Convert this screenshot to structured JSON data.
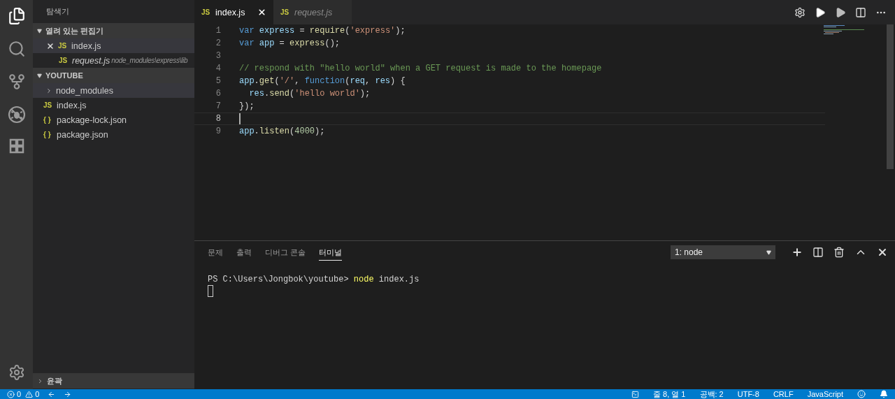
{
  "sidebar": {
    "title": "탐색기",
    "sections": [
      {
        "title": "열려 있는 편집기",
        "expanded": true,
        "items": [
          {
            "kind": "open-editor",
            "badge": "JS",
            "name": "index.js",
            "selected": true,
            "preview": false,
            "closable": true
          },
          {
            "kind": "open-editor",
            "badge": "JS",
            "name": "request.js",
            "description": "node_modules\\express\\lib",
            "selected": false,
            "preview": true,
            "closable": false
          }
        ]
      },
      {
        "title": "YOUTUBE",
        "expanded": true,
        "items": [
          {
            "kind": "folder",
            "name": "node_modules",
            "expanded": false,
            "selected": true
          },
          {
            "kind": "file",
            "badge": "JS",
            "name": "index.js",
            "selected": false
          },
          {
            "kind": "file",
            "badge": "{ }",
            "name": "package-lock.json",
            "selected": false
          },
          {
            "kind": "file",
            "badge": "{ }",
            "name": "package.json",
            "selected": false
          }
        ]
      }
    ],
    "outline": {
      "title": "윤곽",
      "expanded": false
    }
  },
  "tabs": [
    {
      "badge": "JS",
      "name": "index.js",
      "selected": true,
      "preview": false
    },
    {
      "badge": "JS",
      "name": "request.js",
      "selected": false,
      "preview": true
    }
  ],
  "code": [
    {
      "number": "1",
      "current": false,
      "tokens": [
        {
          "kind": "keyword",
          "text": "var "
        },
        {
          "kind": "variable",
          "text": "express"
        },
        {
          "kind": "plain",
          "text": " = "
        },
        {
          "kind": "function",
          "text": "require"
        },
        {
          "kind": "plain",
          "text": "("
        },
        {
          "kind": "string",
          "text": "'express'"
        },
        {
          "kind": "plain",
          "text": ");"
        }
      ]
    },
    {
      "number": "2",
      "current": false,
      "tokens": [
        {
          "kind": "keyword",
          "text": "var "
        },
        {
          "kind": "variable",
          "text": "app"
        },
        {
          "kind": "plain",
          "text": " = "
        },
        {
          "kind": "function",
          "text": "express"
        },
        {
          "kind": "plain",
          "text": "();"
        }
      ]
    },
    {
      "number": "3",
      "current": false
    },
    {
      "number": "4",
      "current": false,
      "tokens": [
        {
          "kind": "comment",
          "text": "// respond with \"hello world\" when a GET request is made to the homepage"
        }
      ]
    },
    {
      "number": "5",
      "current": false,
      "tokens": [
        {
          "kind": "variable",
          "text": "app"
        },
        {
          "kind": "plain",
          "text": "."
        },
        {
          "kind": "function",
          "text": "get"
        },
        {
          "kind": "plain",
          "text": "("
        },
        {
          "kind": "string",
          "text": "'/'"
        },
        {
          "kind": "plain",
          "text": ", "
        },
        {
          "kind": "keyword",
          "text": "function"
        },
        {
          "kind": "plain",
          "text": "("
        },
        {
          "kind": "variable",
          "text": "req"
        },
        {
          "kind": "plain",
          "text": ", "
        },
        {
          "kind": "variable",
          "text": "res"
        },
        {
          "kind": "plain",
          "text": ") {"
        }
      ]
    },
    {
      "number": "6",
      "current": false,
      "tokens": [
        {
          "kind": "variable",
          "text": "  res"
        },
        {
          "kind": "plain",
          "text": "."
        },
        {
          "kind": "function",
          "text": "send"
        },
        {
          "kind": "plain",
          "text": "("
        },
        {
          "kind": "string",
          "text": "'hello world'"
        },
        {
          "kind": "plain",
          "text": ");"
        }
      ]
    },
    {
      "number": "7",
      "current": false,
      "tokens": [
        {
          "kind": "plain",
          "text": "});"
        }
      ]
    },
    {
      "number": "8",
      "current": true
    },
    {
      "number": "9",
      "current": false,
      "tokens": [
        {
          "kind": "variable",
          "text": "app"
        },
        {
          "kind": "plain",
          "text": "."
        },
        {
          "kind": "function",
          "text": "listen"
        },
        {
          "kind": "plain",
          "text": "("
        },
        {
          "kind": "number",
          "text": "4000"
        },
        {
          "kind": "plain",
          "text": ");"
        }
      ]
    }
  ],
  "panel": {
    "tabs": [
      {
        "label": "문제",
        "selected": false
      },
      {
        "label": "출력",
        "selected": false
      },
      {
        "label": "디버그 콘솔",
        "selected": false
      },
      {
        "label": "터미널",
        "selected": true
      }
    ],
    "terminal_select": "1: node",
    "terminal": [
      {
        "tokens": [
          {
            "kind": "plain",
            "text": "PS C:\\Users\\Jongbok\\youtube> "
          },
          {
            "kind": "command",
            "text": "node"
          },
          {
            "kind": "plain",
            "text": " index.js"
          }
        ]
      }
    ]
  },
  "status_bar": {
    "errors": "0",
    "warnings": "0",
    "position": "줄 8, 열 1",
    "indent": "공백: 2",
    "encoding": "UTF-8",
    "eol": "CRLF",
    "language": "JavaScript"
  }
}
